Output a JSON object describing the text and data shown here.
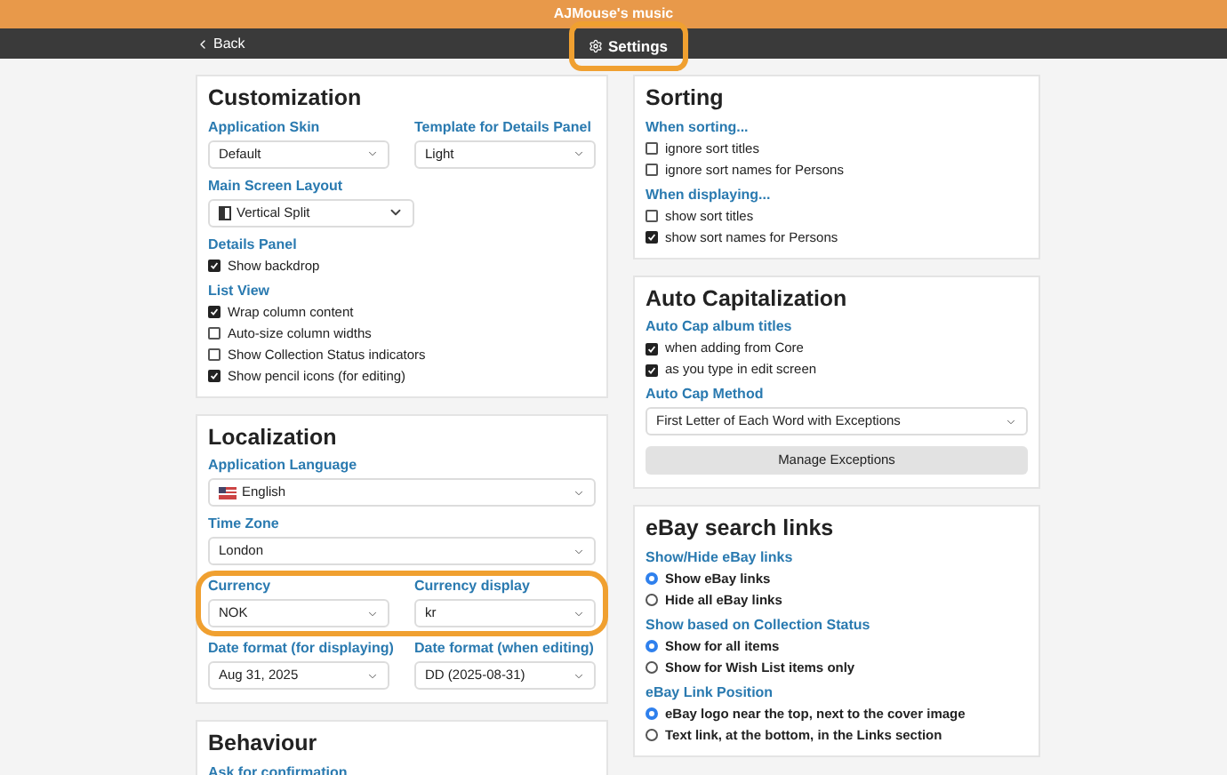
{
  "window": {
    "title": "AJMouse's music"
  },
  "nav": {
    "back": "Back",
    "title": "Settings",
    "title_annotated": true
  },
  "columns": [
    [
      {
        "title": "Customization",
        "blocks": [
          {
            "kind": "selects",
            "annotated": false,
            "fields": [
              {
                "label": "Application Skin",
                "value": "Default",
                "kind": "plain"
              },
              {
                "label": "Template for Details Panel",
                "value": "Light",
                "kind": "plain"
              }
            ]
          },
          {
            "kind": "selects",
            "annotated": false,
            "fields": [
              {
                "label": "Main Screen Layout",
                "value": "Vertical Split",
                "kind": "layout"
              }
            ]
          },
          {
            "kind": "checks",
            "label": "Details Panel",
            "items": [
              {
                "label": "Show backdrop",
                "checked": true
              }
            ]
          },
          {
            "kind": "checks",
            "label": "List View",
            "items": [
              {
                "label": "Wrap column content",
                "checked": true
              },
              {
                "label": "Auto-size column widths",
                "checked": false
              },
              {
                "label": "Show Collection Status indicators",
                "checked": false
              },
              {
                "label": "Show pencil icons (for editing)",
                "checked": true
              }
            ]
          }
        ]
      },
      {
        "title": "Localization",
        "blocks": [
          {
            "kind": "selects",
            "annotated": false,
            "fields": [
              {
                "label": "Application Language",
                "value": "English",
                "kind": "language"
              }
            ]
          },
          {
            "kind": "selects",
            "annotated": false,
            "fields": [
              {
                "label": "Time Zone",
                "value": "London",
                "kind": "plain"
              }
            ]
          },
          {
            "kind": "selects",
            "annotated": true,
            "fields": [
              {
                "label": "Currency",
                "value": "NOK",
                "kind": "plain"
              },
              {
                "label": "Currency display",
                "value": "kr",
                "kind": "plain"
              }
            ]
          },
          {
            "kind": "selects",
            "annotated": false,
            "fields": [
              {
                "label": "Date format (for displaying)",
                "value": "Aug 31, 2025",
                "kind": "plain"
              },
              {
                "label": "Date format (when editing)",
                "value": "DD (2025-08-31)",
                "kind": "plain"
              }
            ]
          }
        ]
      },
      {
        "title": "Behaviour",
        "blocks": [
          {
            "kind": "checks",
            "label": "Ask for confirmation"
          }
        ]
      }
    ],
    [
      {
        "title": "Sorting",
        "blocks": [
          {
            "kind": "checks",
            "label": "When sorting...",
            "items": [
              {
                "label": "ignore sort titles",
                "checked": false
              },
              {
                "label": "ignore sort names for Persons",
                "checked": false
              }
            ]
          },
          {
            "kind": "checks",
            "label": "When displaying...",
            "items": [
              {
                "label": "show sort titles",
                "checked": false
              },
              {
                "label": "show sort names for Persons",
                "checked": true
              }
            ]
          }
        ]
      },
      {
        "title": "Auto Capitalization",
        "blocks": [
          {
            "kind": "checks",
            "label": "Auto Cap album titles",
            "items": [
              {
                "label": "when adding from Core",
                "checked": true
              },
              {
                "label": "as you type in edit screen",
                "checked": true
              }
            ]
          },
          {
            "kind": "selects",
            "annotated": false,
            "fields": [
              {
                "label": "Auto Cap Method",
                "value": "First Letter of Each Word with Exceptions",
                "kind": "plain"
              }
            ]
          },
          {
            "kind": "button",
            "label": "Manage Exceptions"
          }
        ]
      },
      {
        "title": "eBay search links",
        "blocks": [
          {
            "kind": "radios",
            "label": "Show/Hide eBay links",
            "items": [
              {
                "label": "Show eBay links",
                "selected": true
              },
              {
                "label": "Hide all eBay links",
                "selected": false
              }
            ]
          },
          {
            "kind": "radios",
            "label": "Show based on Collection Status",
            "items": [
              {
                "label": "Show for all items",
                "selected": true
              },
              {
                "label": "Show for Wish List items only",
                "selected": false
              }
            ]
          },
          {
            "kind": "radios",
            "label": "eBay Link Position",
            "items": [
              {
                "label": "eBay logo near the top, next to the cover image",
                "selected": true
              },
              {
                "label": "Text link, at the bottom, in the Links section",
                "selected": false
              }
            ]
          }
        ]
      }
    ]
  ]
}
